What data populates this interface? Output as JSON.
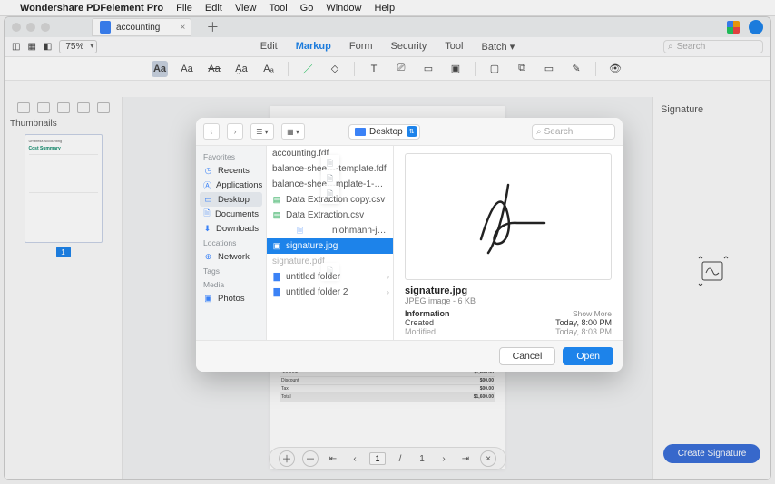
{
  "mac_menu": {
    "app": "Wondershare PDFelement Pro",
    "items": [
      "File",
      "Edit",
      "View",
      "Tool",
      "Go",
      "Window",
      "Help"
    ]
  },
  "tab": {
    "name": "accounting"
  },
  "zoom": "75%",
  "menutabs": [
    "Edit",
    "Markup",
    "Form",
    "Security",
    "Tool",
    "Batch"
  ],
  "menutabs_dropdown": "▾",
  "search_placeholder": "Search",
  "thumbnails_label": "Thumbnails",
  "thumb_page": {
    "brand": "Umbrella Accounting",
    "title": "Cost Summary"
  },
  "thumb_num": "1",
  "doc_table": [
    [
      "Subtotal",
      "$1,600.00"
    ],
    [
      "Discount",
      "$00.00"
    ],
    [
      "Tax",
      "$00.00"
    ],
    [
      "Total",
      "$1,600.00"
    ]
  ],
  "pager": {
    "page": "1",
    "total": "1"
  },
  "right_panel_title": "Signature",
  "create_btn": "Create Signature",
  "dialog": {
    "location": "Desktop",
    "search_placeholder": "Search",
    "sidebar": {
      "favorites_hdr": "Favorites",
      "favorites": [
        {
          "icon": "clock",
          "label": "Recents"
        },
        {
          "icon": "apps",
          "label": "Applications"
        },
        {
          "icon": "desktop",
          "label": "Desktop",
          "selected": true
        },
        {
          "icon": "doc",
          "label": "Documents"
        },
        {
          "icon": "down",
          "label": "Downloads"
        }
      ],
      "locations_hdr": "Locations",
      "locations": [
        {
          "icon": "globe",
          "label": "Network"
        }
      ],
      "tags_hdr": "Tags",
      "media_hdr": "Media",
      "media": [
        {
          "icon": "photo",
          "label": "Photos"
        }
      ]
    },
    "files": [
      {
        "kind": "doc",
        "name": "accounting.fdf"
      },
      {
        "kind": "doc",
        "name": "balance-shee…-template.fdf"
      },
      {
        "kind": "doc",
        "name": "balance-shee…mplate-1-1.fdf"
      },
      {
        "kind": "csv",
        "name": "Data Extraction copy.csv"
      },
      {
        "kind": "csv",
        "name": "Data Extraction.csv"
      },
      {
        "kind": "txt",
        "name": "nlohmann-json-license.txt"
      },
      {
        "kind": "jpg",
        "name": "signature.jpg",
        "selected": true
      },
      {
        "kind": "doc",
        "name": "signature.pdf",
        "dim": true
      },
      {
        "kind": "fold",
        "name": "untitled folder",
        "arrow": true
      },
      {
        "kind": "fold",
        "name": "untitled folder 2",
        "arrow": true
      }
    ],
    "preview": {
      "filename": "signature.jpg",
      "meta": "JPEG image - 6 KB",
      "info_label": "Information",
      "show_more": "Show More",
      "rows": [
        {
          "k": "Created",
          "v": "Today, 8:00 PM"
        },
        {
          "k": "Modified",
          "v": "Today, 8:03 PM"
        }
      ]
    },
    "cancel": "Cancel",
    "open": "Open"
  }
}
